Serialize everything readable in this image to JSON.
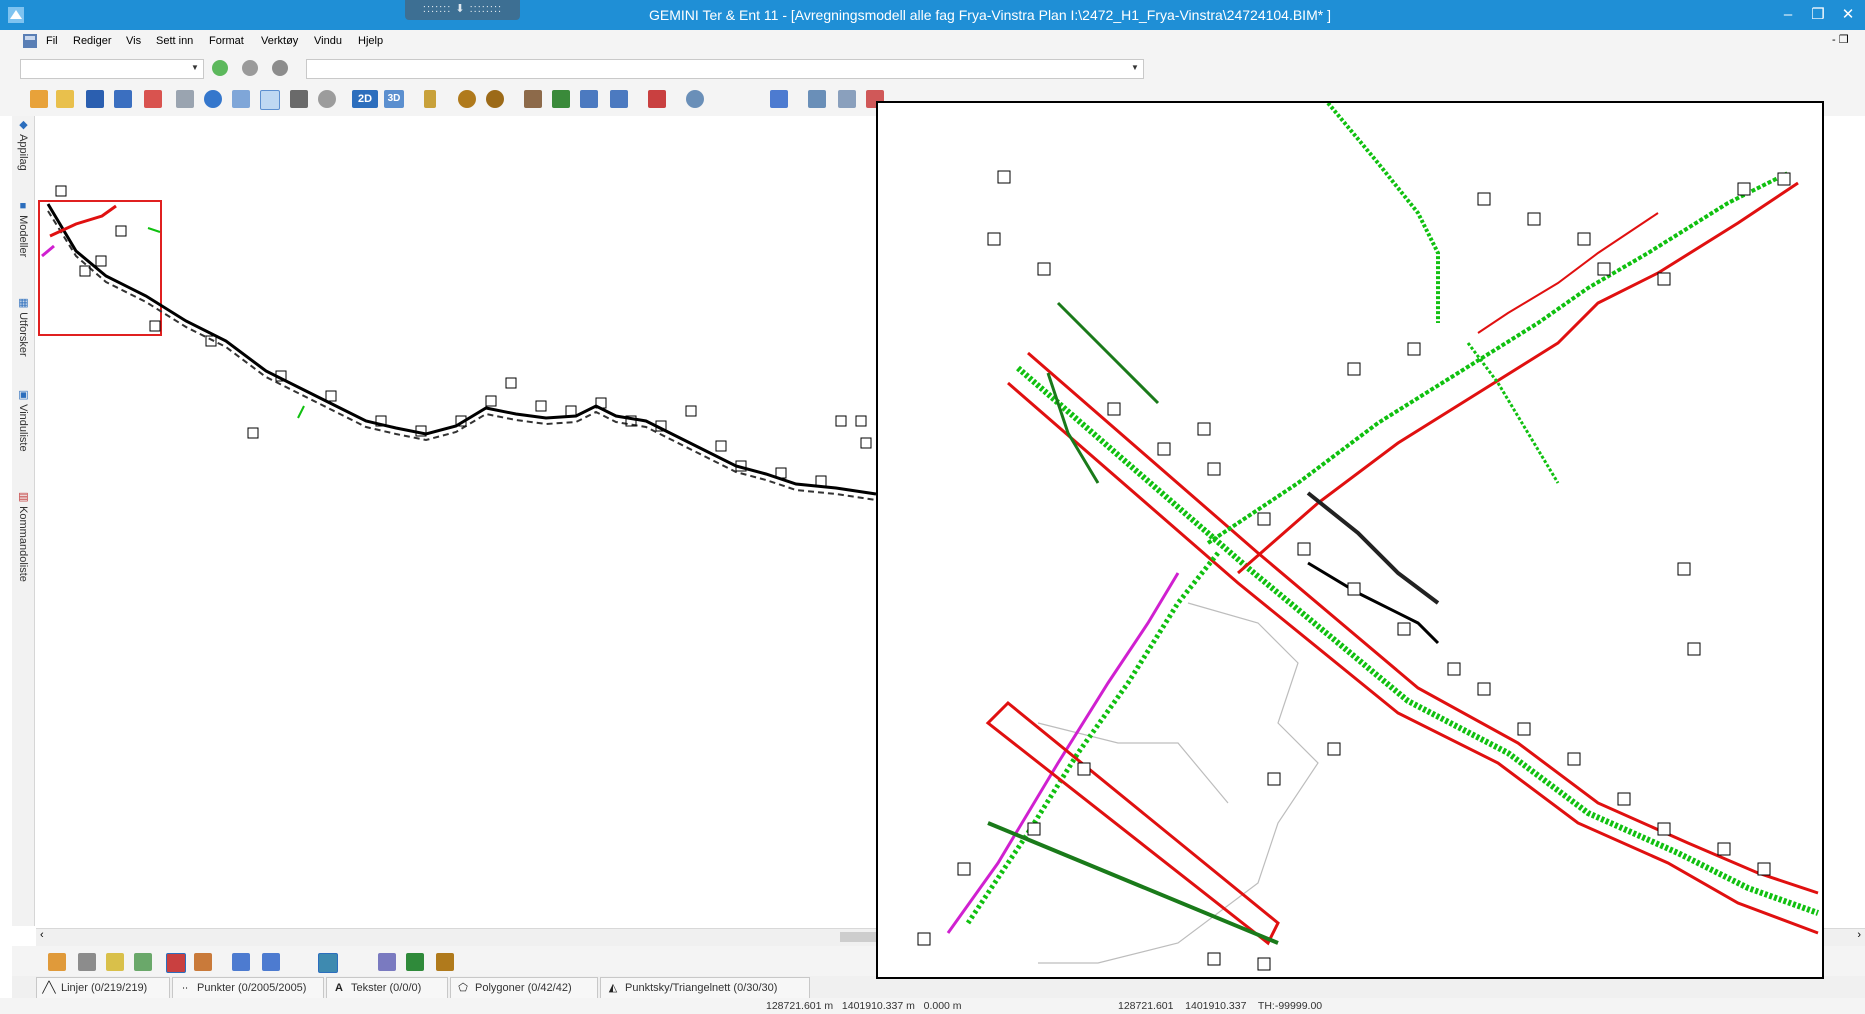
{
  "window": {
    "title": "GEMINI Ter & Ent 11 - [Avregningsmodell alle fag Frya-Vinstra  Plan  I:\\2472_H1_Frya-Vinstra\\24724104.BIM* ]",
    "grip_label": "::::::: ⬇ ::::::::",
    "controls": {
      "minimize": "–",
      "restore": "❒",
      "close": "✕"
    }
  },
  "menu": {
    "items": [
      "Fil",
      "Rediger",
      "Vis",
      "Sett inn",
      "Format",
      "Verktøy",
      "Vindu",
      "Hjelp"
    ],
    "mdi_controls": "- ❒"
  },
  "side_panel": {
    "tabs": [
      "Appilag",
      "Modeller",
      "Utforsker",
      "Vinduliste",
      "Kommandoliste"
    ]
  },
  "toolbar": {
    "view_2d_label": "2D",
    "view_3d_label": "3D"
  },
  "layer_tabs": [
    {
      "icon": "line-icon",
      "glyph": "╱╲",
      "label": "Linjer (0/219/219)"
    },
    {
      "icon": "points-icon",
      "glyph": "∙∙",
      "label": "Punkter (0/2005/2005)"
    },
    {
      "icon": "text-icon",
      "glyph": "A",
      "label": "Tekster (0/0/0)"
    },
    {
      "icon": "polygon-icon",
      "glyph": "⬠",
      "label": "Polygoner (0/42/42)"
    },
    {
      "icon": "pointcloud-icon",
      "glyph": "◭",
      "label": "Punktsky/Triangelnett (0/30/30)"
    }
  ],
  "status": {
    "coords_left": "128721.601 m   1401910.337 m   0.000 m",
    "coords_right": "128721.601    1401910.337    TH:-99999.00"
  },
  "colors": {
    "titlebar": "#1f8fd6",
    "selection_frame": "#e02020",
    "feature_red": "#e01010",
    "feature_green": "#10c010",
    "feature_darkgreen": "#1a7a1a",
    "feature_magenta": "#d020d0"
  }
}
